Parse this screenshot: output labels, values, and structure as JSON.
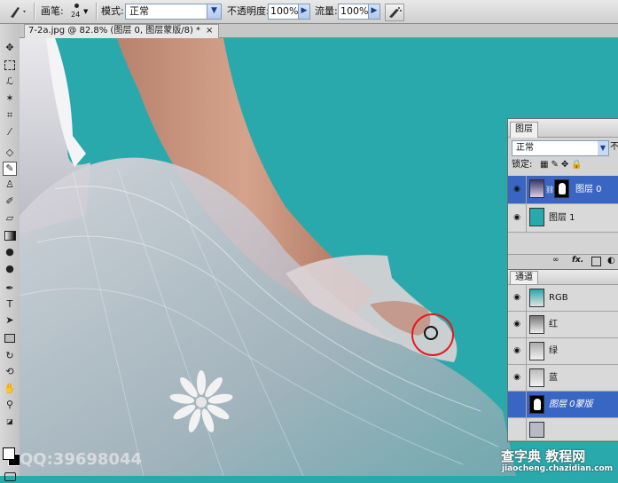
{
  "options_bar": {
    "brush_label": "画笔:",
    "brush_size": "24",
    "mode_label": "模式:",
    "mode_value": "正常",
    "opacity_label": "不透明度:",
    "opacity_value": "100%",
    "flow_label": "流量:",
    "flow_value": "100%"
  },
  "document": {
    "tab_title": "7-2a.jpg @ 82.8% (图层 0, 图层蒙版/8) *",
    "close_glyph": "×"
  },
  "layers_panel": {
    "tab": "图层",
    "blend_mode": "正常",
    "opacity_cut": "不",
    "lock_label": "锁定:",
    "layers": [
      {
        "name": "图层 0",
        "selected": true
      },
      {
        "name": "图层 1",
        "selected": false
      }
    ],
    "footer_icons": [
      "link-icon",
      "fx-icon",
      "mask-icon",
      "adjustment-icon"
    ]
  },
  "channels_panel": {
    "tab": "通道",
    "channels": [
      {
        "name": "RGB",
        "selected": false
      },
      {
        "name": "红",
        "selected": false
      },
      {
        "name": "绿",
        "selected": false
      },
      {
        "name": "蓝",
        "selected": false
      },
      {
        "name": "图层 0蒙版",
        "selected": true
      }
    ]
  },
  "watermarks": {
    "qq": "QQ:39698044",
    "site_cn": "查字典 教程网",
    "site_url": "jiaocheng.chazidian.com"
  },
  "colors": {
    "canvas_bg": "#2aa9ad",
    "selection_blue": "#3a66c3",
    "brush_cursor": "#e01c1c"
  }
}
